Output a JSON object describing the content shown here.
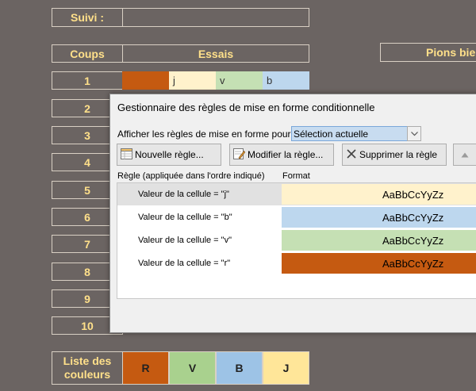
{
  "sheet": {
    "suivi_label": "Suivi :",
    "coups_header": "Coups",
    "essais_header": "Essais",
    "pions_header": "Pions bie",
    "row_numbers": [
      "1",
      "2",
      "3",
      "4",
      "5",
      "6",
      "7",
      "8",
      "9",
      "10"
    ],
    "first_try": [
      {
        "text": "",
        "color": "#c55a11"
      },
      {
        "text": "j",
        "color": "#fff2cc"
      },
      {
        "text": "v",
        "color": "#c5e0b4"
      },
      {
        "text": "b",
        "color": "#bdd7ee"
      }
    ],
    "legend_label_line1": "Liste des",
    "legend_label_line2": "couleurs",
    "legend": [
      {
        "text": "R",
        "color": "#c55a11"
      },
      {
        "text": "V",
        "color": "#a9d18e"
      },
      {
        "text": "B",
        "color": "#9dc3e6"
      },
      {
        "text": "J",
        "color": "#ffe699"
      }
    ]
  },
  "dialog": {
    "title": "Gestionnaire des règles de mise en forme conditionnelle",
    "show_rules_label": "Afficher les règles de mise en forme pour :",
    "show_rules_value": "Sélection actuelle",
    "buttons": {
      "new_rule": "Nouvelle règle...",
      "edit_rule": "Modifier la règle...",
      "delete_rule": "Supprimer la règle"
    },
    "col_rule": "Règle (appliquée dans l'ordre indiqué)",
    "col_format": "Format",
    "rules": [
      {
        "condition": "Valeur de la cellule = \"j\"",
        "preview": "AaBbCcYyZz",
        "color": "#fff2cc",
        "selected": true
      },
      {
        "condition": "Valeur de la cellule = \"b\"",
        "preview": "AaBbCcYyZz",
        "color": "#bdd7ee",
        "selected": false
      },
      {
        "condition": "Valeur de la cellule = \"v\"",
        "preview": "AaBbCcYyZz",
        "color": "#c5e0b4",
        "selected": false
      },
      {
        "condition": "Valeur de la cellule = \"r\"",
        "preview": "AaBbCcYyZz",
        "color": "#c55a11",
        "selected": false
      }
    ]
  },
  "colors": {
    "sheet_bg": "#6b6462",
    "header_text": "#ffe08a",
    "combo_highlight": "#c8dcf0",
    "selected_row": "#e1e1e1"
  }
}
